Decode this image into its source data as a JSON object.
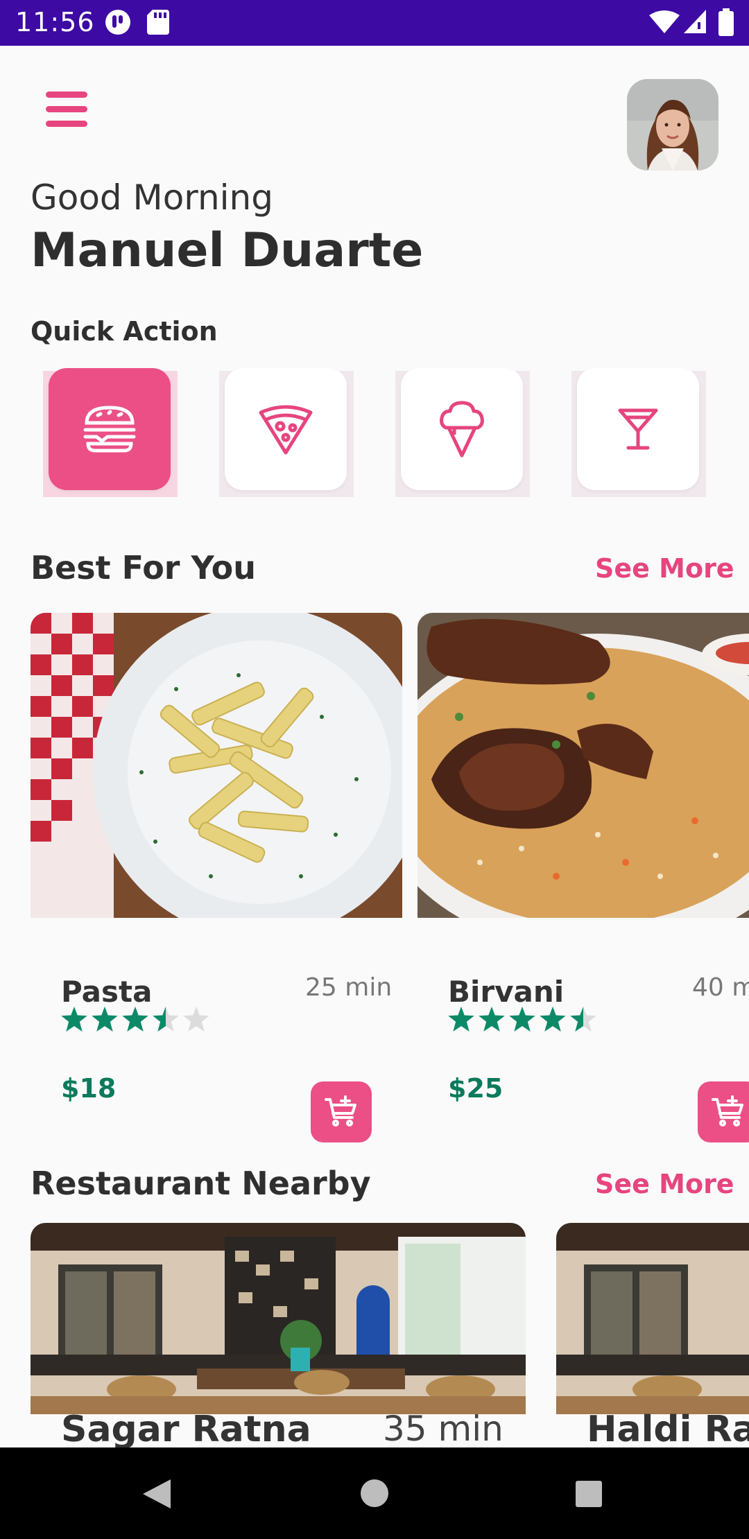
{
  "status_bar": {
    "time": "11:56"
  },
  "header": {
    "greeting": "Good Morning",
    "user_name": "Manuel Duarte"
  },
  "quick_action": {
    "title": "Quick Action",
    "items": [
      {
        "icon": "burger-icon",
        "active": true
      },
      {
        "icon": "pizza-icon",
        "active": false
      },
      {
        "icon": "ice-cream-icon",
        "active": false
      },
      {
        "icon": "cocktail-icon",
        "active": false
      }
    ]
  },
  "best_for_you": {
    "title": "Best For You",
    "see_more": "See More",
    "items": [
      {
        "name": "Pasta",
        "time": "25 min",
        "rating": 3.5,
        "price": "$18"
      },
      {
        "name": "Birvani",
        "time": "40 m",
        "rating": 4.5,
        "price": "$25"
      }
    ]
  },
  "restaurant_nearby": {
    "title": "Restaurant Nearby",
    "see_more": "See More",
    "items": [
      {
        "name": "Sagar Ratna",
        "time": "35 min"
      },
      {
        "name": "Haldi Ran",
        "time": ""
      }
    ]
  },
  "colors": {
    "accent": "#eb4f86",
    "status_bar": "#3d0aa3",
    "price": "#0c7a5d",
    "star": "#0c8a68"
  }
}
